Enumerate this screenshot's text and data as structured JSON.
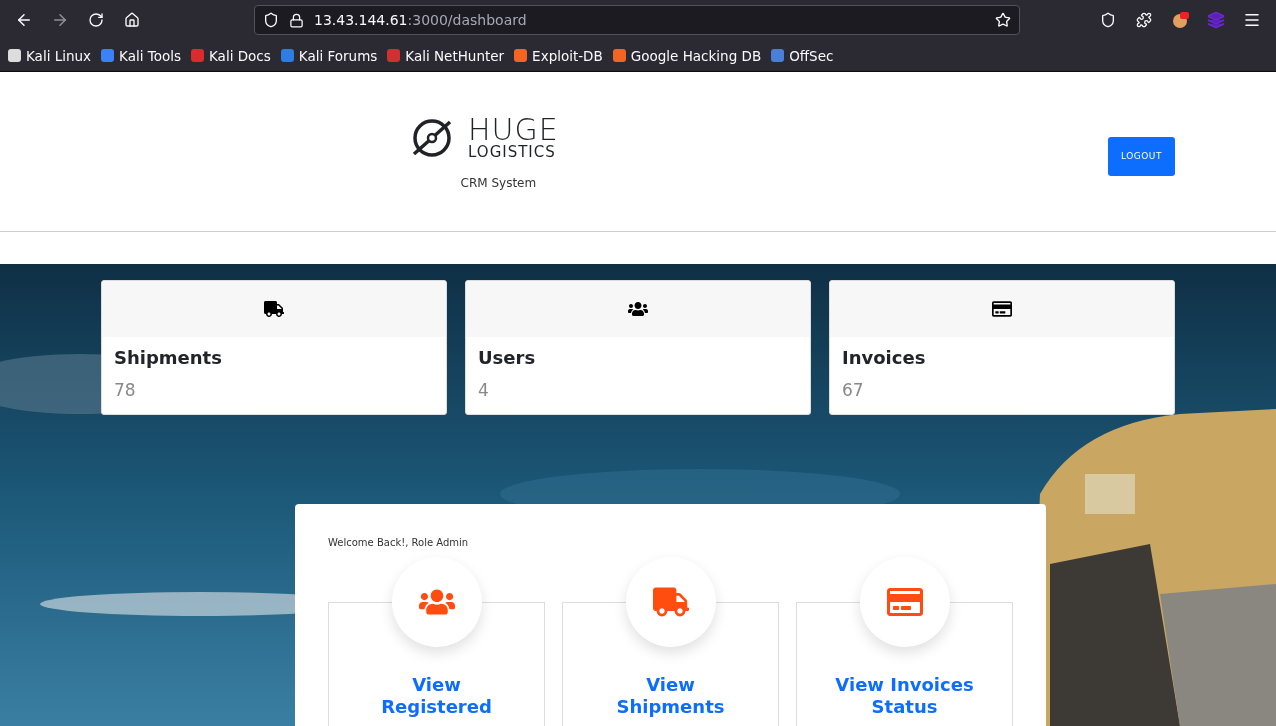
{
  "browser": {
    "address_host": "13.43.144.61",
    "address_path": ":3000/dashboard",
    "bookmarks": [
      {
        "label": "Kali Linux",
        "color": "#dddddd"
      },
      {
        "label": "Kali Tools",
        "color": "#3b82f6"
      },
      {
        "label": "Kali Docs",
        "color": "#d92c2c"
      },
      {
        "label": "Kali Forums",
        "color": "#2f7de1"
      },
      {
        "label": "Kali NetHunter",
        "color": "#d0302f"
      },
      {
        "label": "Exploit-DB",
        "color": "#f26522"
      },
      {
        "label": "Google Hacking DB",
        "color": "#f26522"
      },
      {
        "label": "OffSec",
        "color": "#4a7fd8"
      }
    ]
  },
  "header": {
    "logo_top": "HUGE",
    "logo_bottom": "LOGISTICS",
    "subtitle": "CRM System",
    "logout": "LOGOUT"
  },
  "stats": [
    {
      "kind": "truck",
      "title": "Shipments",
      "value": "78"
    },
    {
      "kind": "users",
      "title": "Users",
      "value": "4"
    },
    {
      "kind": "card",
      "title": "Invoices",
      "value": "67"
    }
  ],
  "welcome": "Welcome Back!, Role Admin",
  "actions": [
    {
      "kind": "users",
      "label": "View Registered"
    },
    {
      "kind": "truck",
      "label": "View Shipments"
    },
    {
      "kind": "card",
      "label": "View Invoices Status"
    }
  ]
}
